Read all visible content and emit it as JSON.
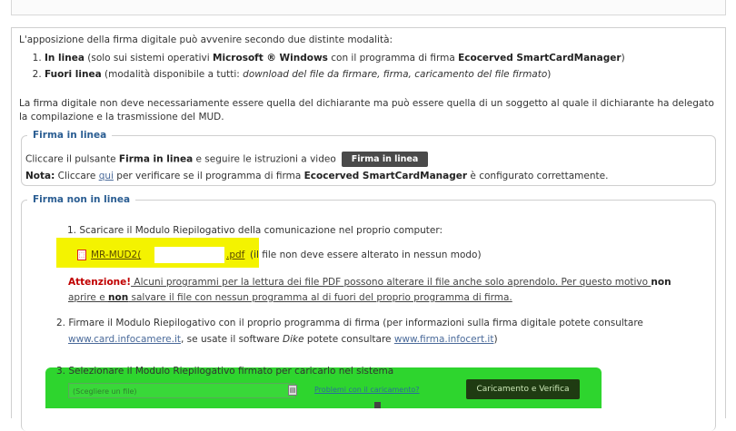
{
  "topbar": {
    "corner_text": ""
  },
  "intro": "L'apposizione della firma digitale può avvenire secondo due distinte modalità:",
  "modes": [
    {
      "title": "In linea",
      "pre": " (solo sui sistemi operativi ",
      "os": "Microsoft ® Windows",
      "mid": " con il programma di firma ",
      "program": "Ecocerved SmartCardManager",
      "post": ")"
    },
    {
      "title": "Fuori linea",
      "pre": " (modalità disponibile a tutti: ",
      "italic": "download del file da firmare, firma, caricamento del file firmato",
      "post": ")"
    }
  ],
  "note": "La firma digitale non deve necessariamente essere quella del dichiarante ma può essere quella di un soggetto al quale il dichiarante ha delegato la compilazione e la trasmissione del MUD.",
  "online": {
    "legend": "Firma in linea",
    "line1_pre": "Cliccare il pulsante ",
    "line1_bold": "Firma in linea",
    "line1_post": " e seguire le istruzioni a video",
    "button": "Firma in linea",
    "nota_label": "Nota:",
    "nota_pre": " Cliccare ",
    "nota_link": "qui",
    "nota_mid": " per verificare se il programma di firma ",
    "nota_program": "Ecocerved SmartCardManager",
    "nota_post": " è configurato correttamente."
  },
  "offline": {
    "legend": "Firma non in linea",
    "step1": "1. Scaricare il Modulo Riepilogativo della comunicazione nel proprio computer:",
    "file_name": "MR-MUD2(",
    "file_ext": ".pdf",
    "file_tail": "(il file non deve essere alterato in nessun modo)",
    "warning_label": "Attenzione!",
    "warning_line1": " Alcuni programmi per la lettura dei file PDF possono alterare il file anche solo aprendolo. Per questo motivo ",
    "warning_non1": "non",
    "warning_line2_pre": "aprire e ",
    "warning_non2": "non",
    "warning_line2_post": " salvare il file con nessun programma al di fuori del proprio programma di firma.",
    "step2_pre": "2. Firmare il Modulo Riepilogativo con il proprio programma di firma (per informazioni sulla firma digitale potete consultare",
    "step2_link1": "www.card.infocamere.it",
    "step2_mid": ", se usate il software ",
    "step2_dike": "Dike",
    "step2_mid2": " potete consultare ",
    "step2_link2": "www.firma.infocert.it",
    "step2_post": ")",
    "step3": "3. Selezionare il Modulo Riepilogativo firmato per caricarlo nel sistema",
    "file_input_placeholder": "(Scegliere un file)",
    "problem_link": "Problemi con il caricamento?",
    "upload_button": "Caricamento e Verifica"
  },
  "colors": {
    "legend": "#2a5d92",
    "highlight_yellow": "#f4f300",
    "highlight_green": "#2ed52e",
    "warning_red": "#c00000"
  }
}
